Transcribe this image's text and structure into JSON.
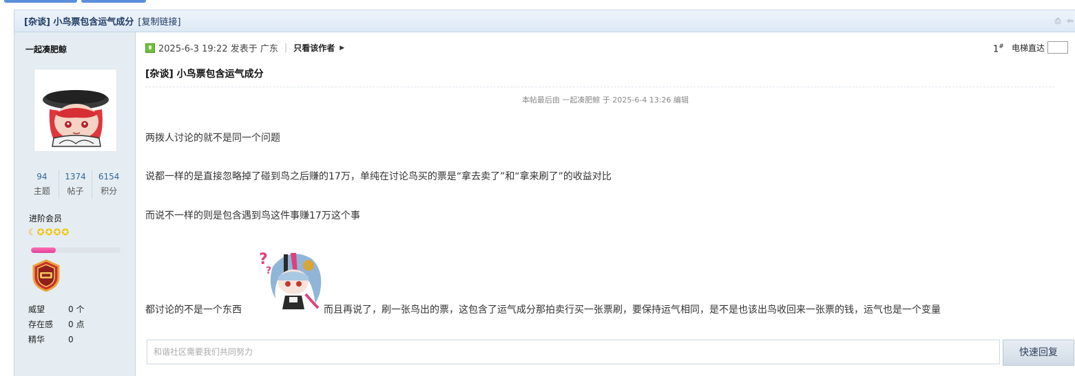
{
  "thread": {
    "title": "[杂谈] 小鸟票包含运气成分",
    "copy_link": "[复制链接]"
  },
  "author": {
    "name": "一起凑肥鲸",
    "stats": [
      {
        "value": "94",
        "label": "主题"
      },
      {
        "value": "1374",
        "label": "帖子"
      },
      {
        "value": "6154",
        "label": "积分"
      }
    ],
    "level": "进阶会员",
    "level_progress": 0.28,
    "profile": [
      {
        "key": "威望",
        "value": "0 个"
      },
      {
        "key": "存在感",
        "value": "0 点"
      },
      {
        "key": "精华",
        "value": "0"
      }
    ]
  },
  "post": {
    "meta": "2025-6-3 19:22 发表于 广东",
    "only_author": "只看该作者",
    "floor": "1",
    "floor_mark": "#",
    "elevator_label": "电梯直达",
    "title": "[杂谈] 小鸟票包含运气成分",
    "edit_note": "本帖最后由 一起凑肥鲸 于 2025-6-4 13:26 编辑",
    "paragraphs": [
      "两拨人讨论的就不是同一个问题",
      "说都一样的是直接忽略掉了碰到鸟之后赚的17万，单纯在讨论鸟买的票是“拿去卖了”和“拿来刷了”的收益对比",
      "而说不一样的则是包含遇到鸟这件事赚17万这个事"
    ],
    "last_line_before": "都讨论的不是一个东西",
    "last_line_after": "而且再说了，刷一张鸟出的票，这包含了运气成分那拍卖行买一张票刷，要保持运气相同，是不是也该出鸟收回来一张票的钱，运气也是一个变量"
  },
  "reply": {
    "placeholder": "和谐社区需要我们共同努力",
    "button": "快速回复"
  }
}
